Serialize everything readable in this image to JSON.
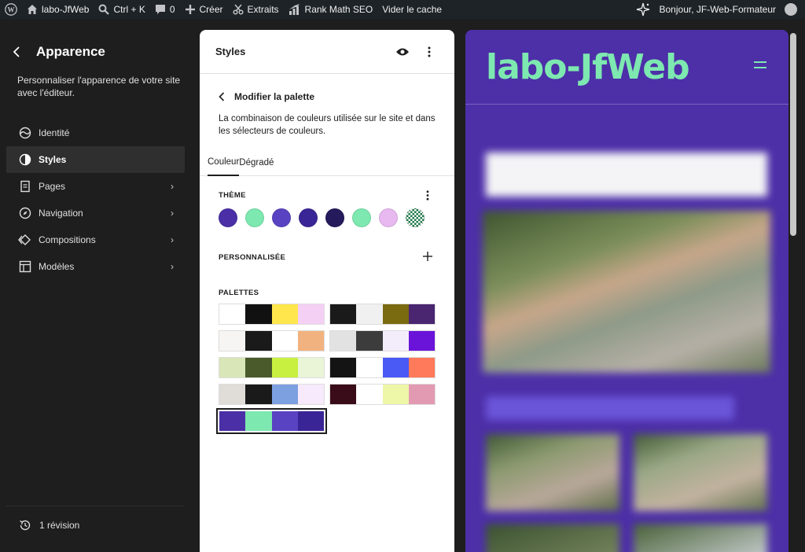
{
  "adminbar": {
    "site_name": "labo-JfWeb",
    "search_shortcut": "Ctrl + K",
    "comments_count": "0",
    "create_label": "Créer",
    "snippets_label": "Extraits",
    "seo_label": "Rank Math SEO",
    "cache_label": "Vider le cache",
    "greeting": "Bonjour, JF-Web-Formateur"
  },
  "sidebar": {
    "title": "Apparence",
    "description": "Personnaliser l'apparence de votre site avec l'éditeur.",
    "items": [
      {
        "label": "Identité",
        "icon": "identity-icon"
      },
      {
        "label": "Styles",
        "icon": "styles-icon",
        "active": true
      },
      {
        "label": "Pages",
        "icon": "pages-icon",
        "chevron": true
      },
      {
        "label": "Navigation",
        "icon": "navigation-icon",
        "chevron": true
      },
      {
        "label": "Compositions",
        "icon": "patterns-icon",
        "chevron": true
      },
      {
        "label": "Modèles",
        "icon": "templates-icon",
        "chevron": true
      }
    ],
    "revision_label": "1 révision"
  },
  "panel": {
    "title": "Styles",
    "subtitle": "Modifier la palette",
    "description": "La combinaison de couleurs utilisée sur le site et dans les sélecteurs de couleurs.",
    "tabs": [
      "Couleur",
      "Dégradé"
    ],
    "theme_label": "THÈME",
    "custom_label": "PERSONNALISÉE",
    "palettes_label": "PALETTES",
    "theme_colors": [
      "#4b2fa6",
      "#7de8b0",
      "#5a43c2",
      "#3a2596",
      "#251a5c",
      "#7de8b0",
      "#e8b8f0",
      "checker"
    ],
    "palettes": [
      [
        "#ffffff",
        "#111111",
        "#ffe64d",
        "#f5d0f5"
      ],
      [
        "#1a1a1a",
        "#f0f0f0",
        "#7a6a10",
        "#4a2570"
      ],
      [
        "#f6f5f3",
        "#1a1a1a",
        "#ffffff",
        "#f2b27f"
      ],
      [
        "#e2e2e2",
        "#3c3c3c",
        "#f3ecfb",
        "#6a14d9"
      ],
      [
        "#d8e6b8",
        "#4a5a2a",
        "#c8f040",
        "#eaf5d8"
      ],
      [
        "#141414",
        "#ffffff",
        "#4a5af5",
        "#ff7a5a"
      ],
      [
        "#e0ddd8",
        "#1a1a1a",
        "#7da0e0",
        "#f7eafc"
      ],
      [
        "#3a0b18",
        "#ffffff",
        "#eef6a8",
        "#e29ab2"
      ],
      [
        "#4b2fa6",
        "#7de8b0",
        "#5a43c2",
        "#3a2596"
      ]
    ],
    "selected_palette": 8
  },
  "preview": {
    "site_title": "labo-JfWeb"
  }
}
